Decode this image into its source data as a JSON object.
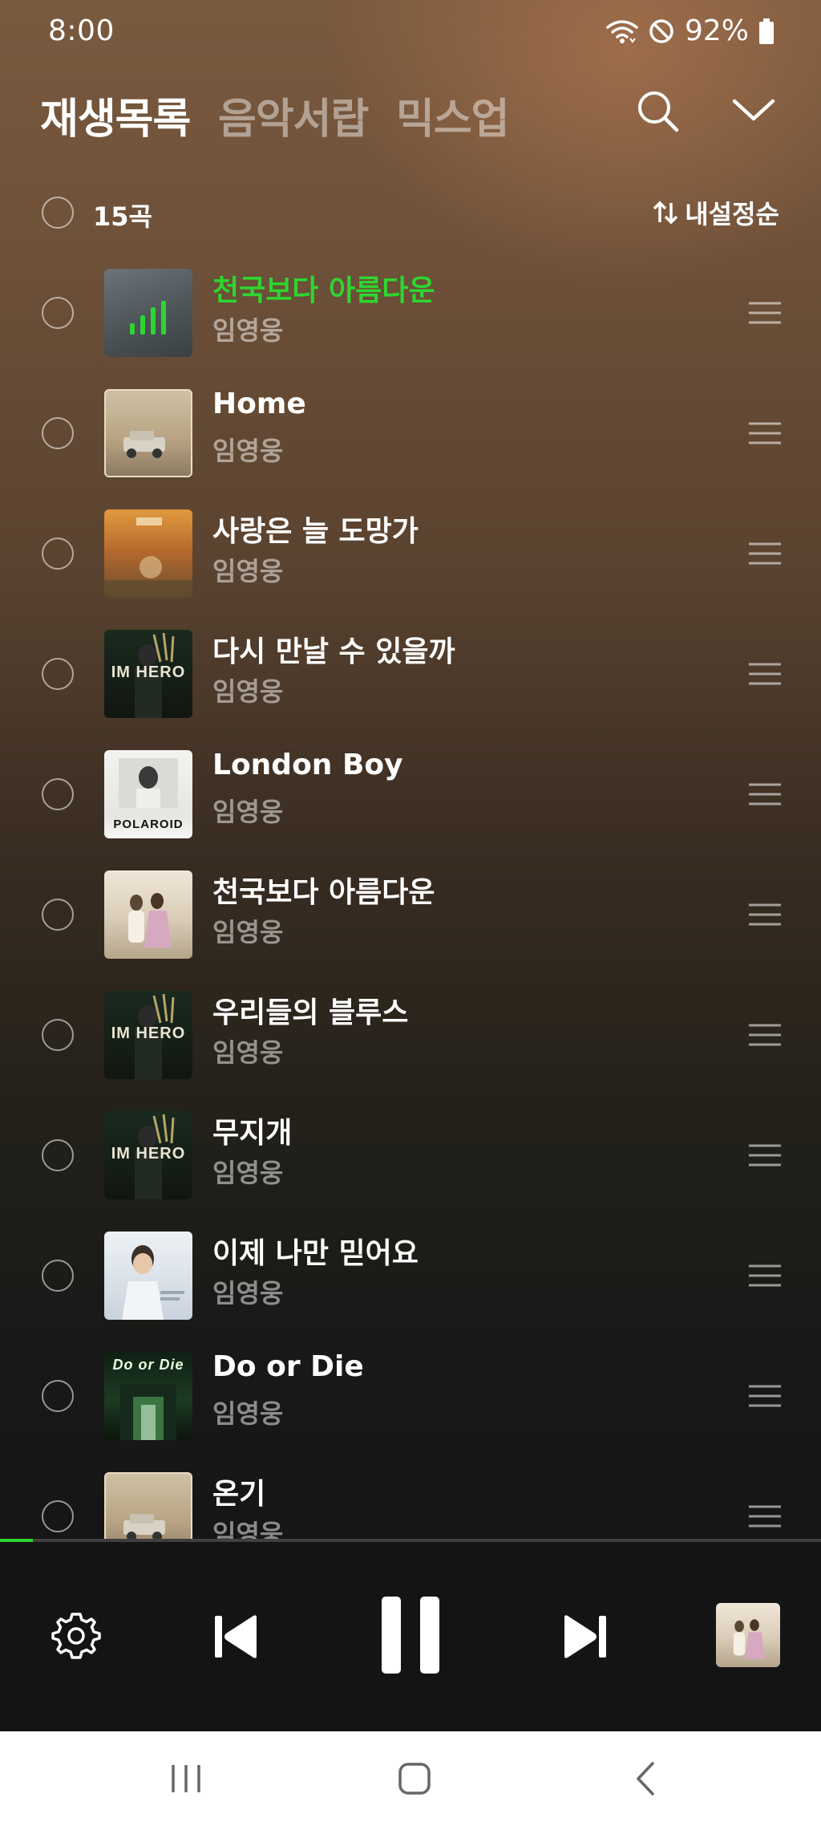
{
  "status_bar": {
    "time": "8:00",
    "battery": "92%",
    "icons": [
      "wifi-icon",
      "do-not-disturb-icon",
      "battery-icon"
    ]
  },
  "header": {
    "tabs": [
      {
        "label": "재생목록",
        "active": true
      },
      {
        "label": "음악서랍",
        "active": false
      },
      {
        "label": "믹스업",
        "active": false
      }
    ],
    "icons": [
      "search-icon",
      "chevron-down-icon"
    ]
  },
  "list_header": {
    "count": "15곡",
    "sort_label": "내설정순",
    "sort_icon": "sort-icon"
  },
  "tracks": [
    {
      "title": "천국보다 아름다운",
      "artist": "임영웅",
      "playing": true
    },
    {
      "title": "Home",
      "artist": "임영웅",
      "playing": false
    },
    {
      "title": "사랑은 늘 도망가",
      "artist": "임영웅",
      "playing": false
    },
    {
      "title": "다시 만날 수 있을까",
      "artist": "임영웅",
      "playing": false,
      "art_text": "IM HERO"
    },
    {
      "title": "London Boy",
      "artist": "임영웅",
      "playing": false,
      "art_text": "POLAROID"
    },
    {
      "title": "천국보다 아름다운",
      "artist": "임영웅",
      "playing": false
    },
    {
      "title": "우리들의 블루스",
      "artist": "임영웅",
      "playing": false,
      "art_text": "IM HERO"
    },
    {
      "title": "무지개",
      "artist": "임영웅",
      "playing": false,
      "art_text": "IM HERO"
    },
    {
      "title": "이제 나만 믿어요",
      "artist": "임영웅",
      "playing": false
    },
    {
      "title": "Do or Die",
      "artist": "임영웅",
      "playing": false,
      "art_text": "Do or Die"
    },
    {
      "title": "온기",
      "artist": "임영웅",
      "playing": false
    }
  ],
  "player": {
    "progress": 0.04,
    "accent_color": "#2fd52f",
    "controls": [
      "settings-icon",
      "skip-previous-icon",
      "pause-icon",
      "skip-next-icon"
    ]
  },
  "nav_bar": {
    "icons": [
      "recent-apps-icon",
      "home-icon",
      "back-icon"
    ]
  }
}
